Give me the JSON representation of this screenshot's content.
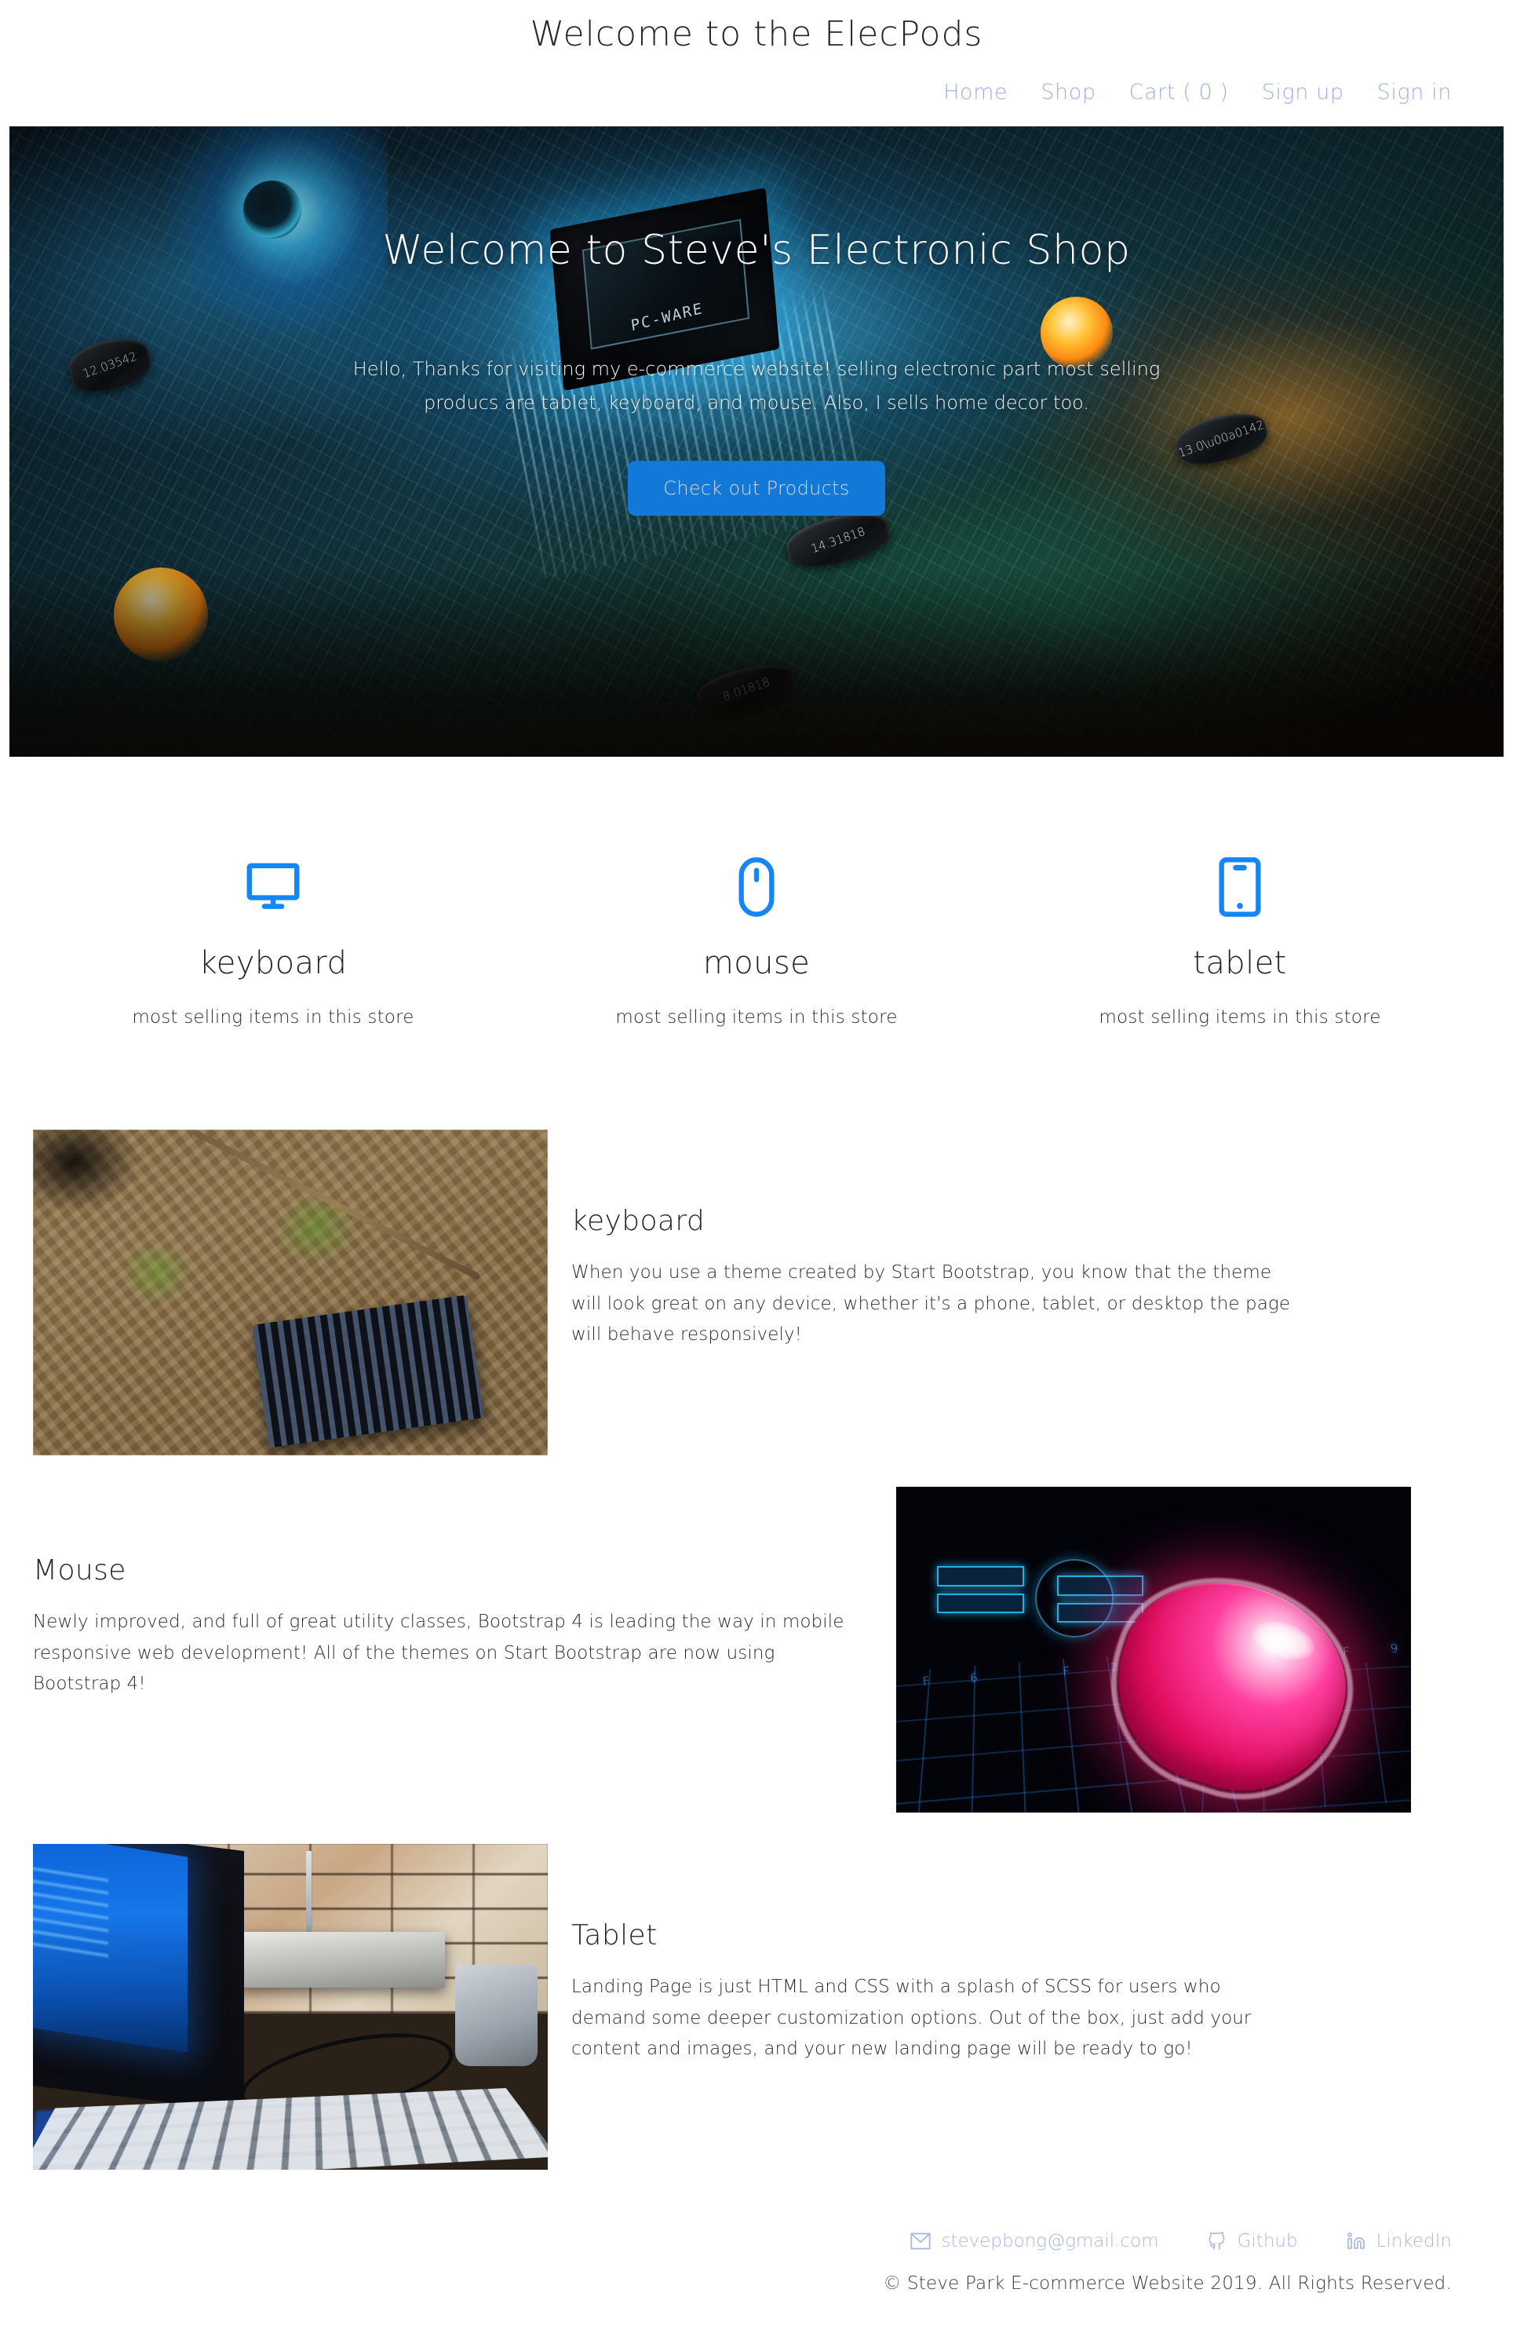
{
  "header": {
    "site_title": "Welcome to the ElecPods",
    "nav": [
      {
        "label": "Home",
        "name": "nav-home"
      },
      {
        "label": "Shop",
        "name": "nav-shop"
      },
      {
        "label": "Cart ( 0 )",
        "name": "nav-cart"
      },
      {
        "label": "Sign up",
        "name": "nav-signup"
      },
      {
        "label": "Sign in",
        "name": "nav-signin"
      }
    ]
  },
  "hero": {
    "title": "Welcome to Steve's Electronic Shop",
    "subtitle": "Hello, Thanks for visiting my e-commerce website! selling electronic part most selling producs are tablet, keyboard, and mouse. Also, I sells home decor too.",
    "cta_label": "Check out Products",
    "cta_color": "#1379d8",
    "image_alt": "circuit board with glowing microchip"
  },
  "features": [
    {
      "icon": "monitor-icon",
      "title": "keyboard",
      "desc": "most selling items in this store"
    },
    {
      "icon": "mouse-icon",
      "title": "mouse",
      "desc": "most selling items in this store"
    },
    {
      "icon": "tablet-icon",
      "title": "tablet",
      "desc": "most selling items in this store"
    }
  ],
  "feature_icon_color": "#1486f5",
  "sections": [
    {
      "id": "keyboard",
      "title": "keyboard",
      "body": "When you use a theme created by Start Bootstrap, you know that the theme will look great on any device, whether it's a phone, tablet, or desktop the page will behave responsively!",
      "image_alt": "black keyboard lying on forest floor leaves",
      "layout": "media-left"
    },
    {
      "id": "mouse",
      "title": "Mouse",
      "body": "Newly improved, and full of great utility classes, Bootstrap 4 is leading the way in mobile responsive web development! All of the themes on Start Bootstrap are now using Bootstrap 4!",
      "image_alt": "glowing pink wireless mouse on blue backlit keyboard",
      "layout": "media-right"
    },
    {
      "id": "tablet",
      "title": "Tablet",
      "body": "Landing Page is just HTML and CSS with a splash of SCSS for users who demand some deeper customization options. Out of the box, just add your content and images, and your new landing page will be ready to go!",
      "image_alt": "desk with blue monitor, keyboard and brick wall",
      "layout": "media-left"
    }
  ],
  "footer": {
    "links": [
      {
        "icon": "envelope-icon",
        "label": "stevepbong@gmail.com",
        "name": "footer-email"
      },
      {
        "icon": "github-icon",
        "label": "Github",
        "name": "footer-github"
      },
      {
        "icon": "linkedin-icon",
        "label": "LinkedIn",
        "name": "footer-linkedin"
      }
    ],
    "copyright": "© Steve Park E-commerce Website 2019. All Rights Reserved.",
    "link_color": "#a9b8e2"
  }
}
